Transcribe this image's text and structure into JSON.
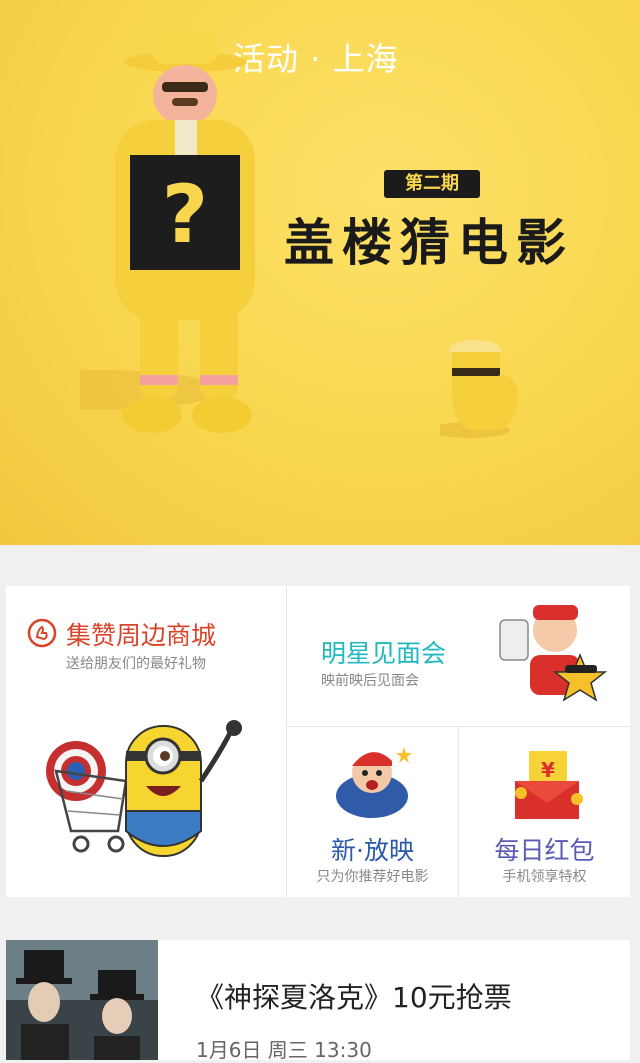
{
  "banner": {
    "location": "活动 · 上海",
    "episode": "第二期",
    "title": "盖楼猜电影",
    "mystery_symbol": "?"
  },
  "features": {
    "mall": {
      "icon": "gift-hand-icon",
      "title": "集赞周边商城",
      "subtitle": "送给朋友们的最好礼物",
      "color": "#d9452b"
    },
    "star": {
      "title": "明星见面会",
      "subtitle": "映前映后见面会",
      "color": "#22b8c0"
    },
    "new_release": {
      "title": "新·放映",
      "subtitle": "只为你推荐好电影",
      "color": "#2a5aa8"
    },
    "red_packet": {
      "title": "每日红包",
      "subtitle": "手机领享特权",
      "color": "#5a5ab5",
      "badge": "¥"
    }
  },
  "event_card": {
    "title": "《神探夏洛克》10元抢票",
    "date": "1月6日 周三 13:30"
  }
}
